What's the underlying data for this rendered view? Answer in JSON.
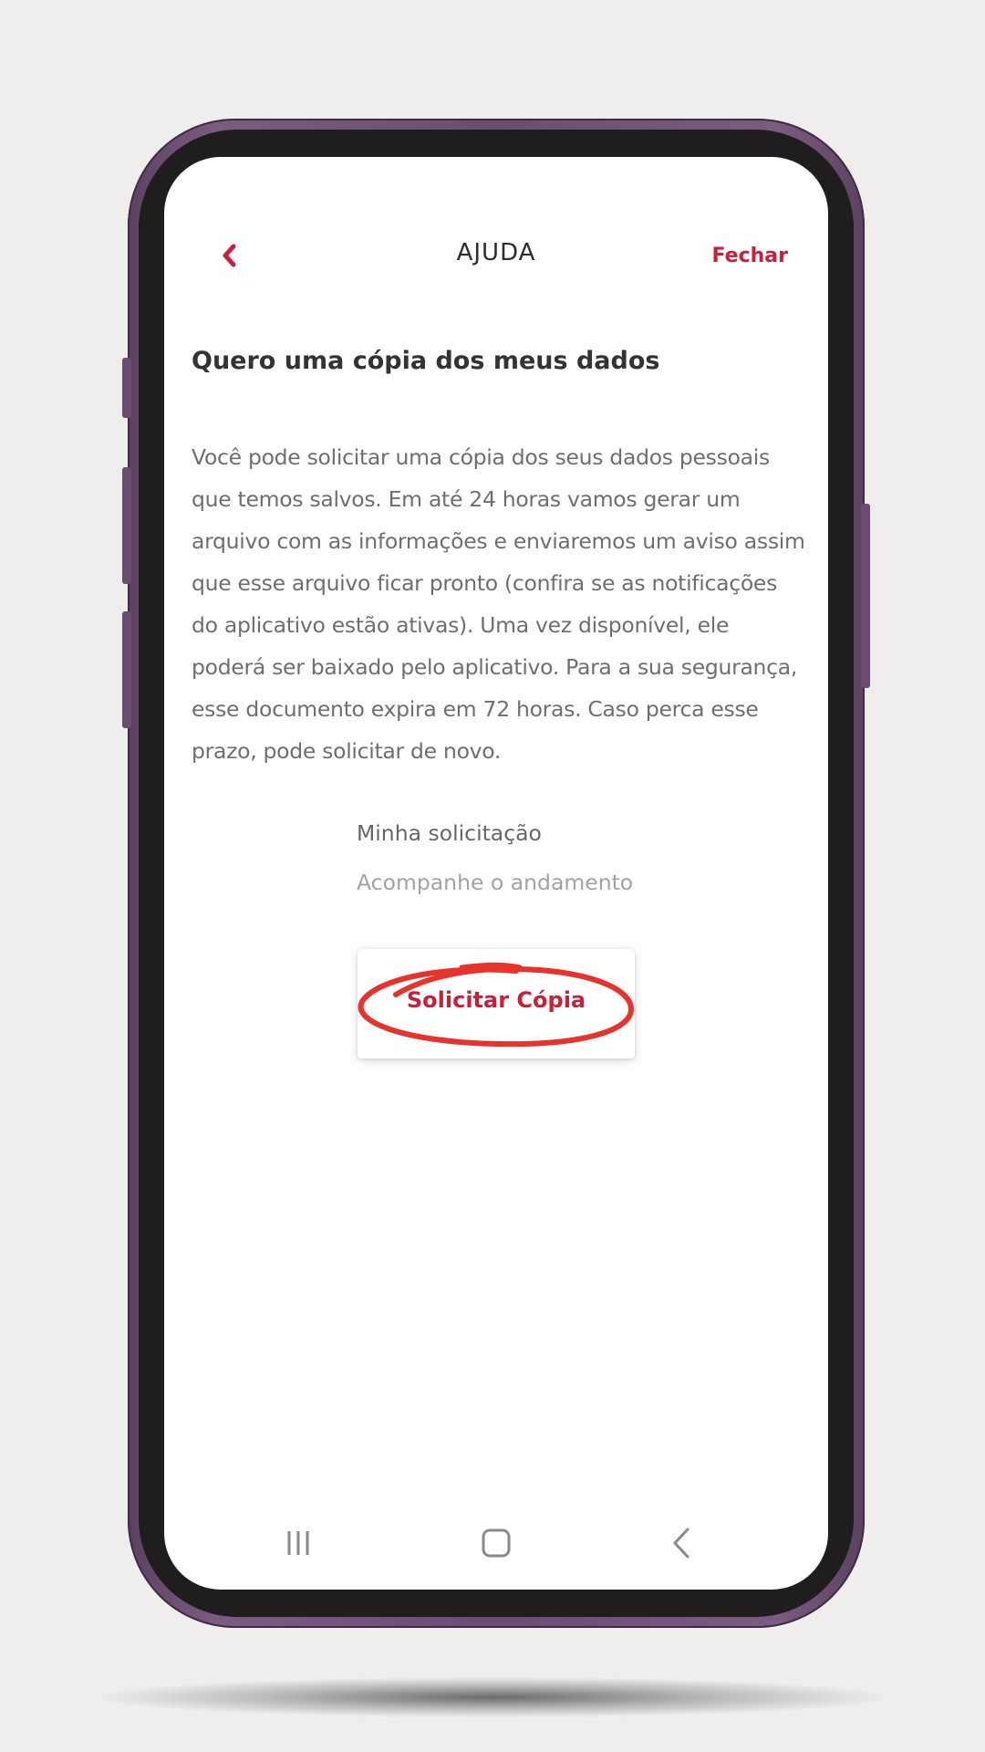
{
  "header": {
    "back_icon": "chevron-left-icon",
    "title": "AJUDA",
    "close_label": "Fechar"
  },
  "content": {
    "headline": "Quero uma cópia dos meus dados",
    "body": "Você pode solicitar uma cópia dos seus dados pessoais que temos salvos. Em até 24 horas vamos gerar um arquivo com as informações e enviaremos um aviso assim que esse arquivo ficar pronto (confira se as notificações do aplicativo estão ativas). Uma vez disponível, ele poderá ser baixado pelo aplicativo. Para a sua segurança, esse documento expira em 72 horas. Caso perca esse prazo, pode solicitar de novo.",
    "request_title": "Minha solicitação",
    "request_subtitle": "Acompanhe o andamento",
    "copy_button_label": "Solicitar Cópia"
  },
  "system_nav": {
    "icons": [
      "recent-apps-icon",
      "home-icon",
      "back-icon"
    ]
  },
  "colors": {
    "accent": "#c8203a",
    "highlight_circle": "#e8322c",
    "phone_frame": "#6a4d6f",
    "background": "#efeeec"
  }
}
